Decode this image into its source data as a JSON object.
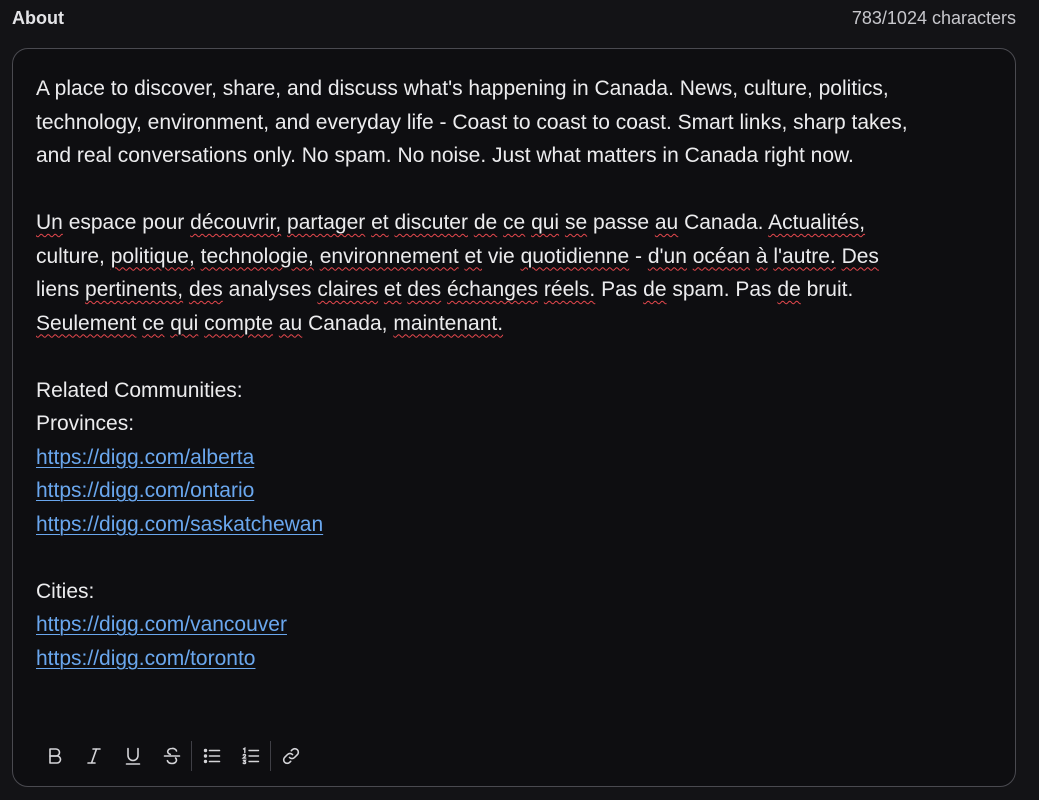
{
  "header": {
    "label": "About",
    "char_count": "783/1024 characters"
  },
  "editor": {
    "en_line1": "A place to discover, share, and discuss what's happening in Canada. News, culture, politics,",
    "en_line2": "technology, environment, and everyday life - Coast to coast to coast. Smart links, sharp takes,",
    "en_line3": "and real conversations only. No spam. No noise. Just what matters in Canada right now.",
    "fr": {
      "w1": "Un",
      "w2": "espace",
      "w3": "pour",
      "w4": "découvrir,",
      "w5": "partager",
      "w6": "et",
      "w7": "discuter",
      "w8": "de",
      "w9": "ce",
      "w10": "qui",
      "w11": "se",
      "w12": "passe",
      "w13": "au",
      "w14": "Canada.",
      "w15": "Actualités,",
      "w16": "culture,",
      "w17": "politique,",
      "w18": "technologie,",
      "w19": "environnement",
      "w20": "et",
      "w21": "vie",
      "w22": "quotidienne",
      "w23": "-",
      "w24": "d'un",
      "w25": "océan",
      "w26": "à",
      "w27": "l'autre.",
      "w28": "Des",
      "w29": "liens",
      "w30": "pertinents,",
      "w31": "des",
      "w32": "analyses",
      "w33": "claires",
      "w34": "et",
      "w35": "des",
      "w36": "échanges",
      "w37": "réels.",
      "w38": "Pas",
      "w39": "de",
      "w40": "spam.",
      "w41": "Pas",
      "w42": "de",
      "w43": "bruit.",
      "w44": "Seulement",
      "w45": "ce",
      "w46": "qui",
      "w47": "compte",
      "w48": "au",
      "w49": "Canada,",
      "w50": "maintenant."
    },
    "related_heading": "Related Communities:",
    "provinces_heading": "Provinces:",
    "province_links": [
      "https://digg.com/alberta",
      "https://digg.com/ontario",
      "https://digg.com/saskatchewan"
    ],
    "cities_heading": "Cities:",
    "city_links": [
      "https://digg.com/vancouver",
      "https://digg.com/toronto"
    ]
  },
  "toolbar": {
    "buttons": [
      {
        "name": "bold",
        "icon": "bold-icon"
      },
      {
        "name": "italic",
        "icon": "italic-icon"
      },
      {
        "name": "underline",
        "icon": "underline-icon"
      },
      {
        "name": "strikethrough",
        "icon": "strikethrough-icon"
      },
      {
        "name": "bullet-list",
        "icon": "bullet-list-icon"
      },
      {
        "name": "numbered-list",
        "icon": "numbered-list-icon"
      },
      {
        "name": "link",
        "icon": "link-icon"
      }
    ]
  },
  "colors": {
    "background": "#131316",
    "editor_bg": "#0e0e11",
    "link": "#6aa7ee",
    "spellcheck": "#e5484d"
  }
}
